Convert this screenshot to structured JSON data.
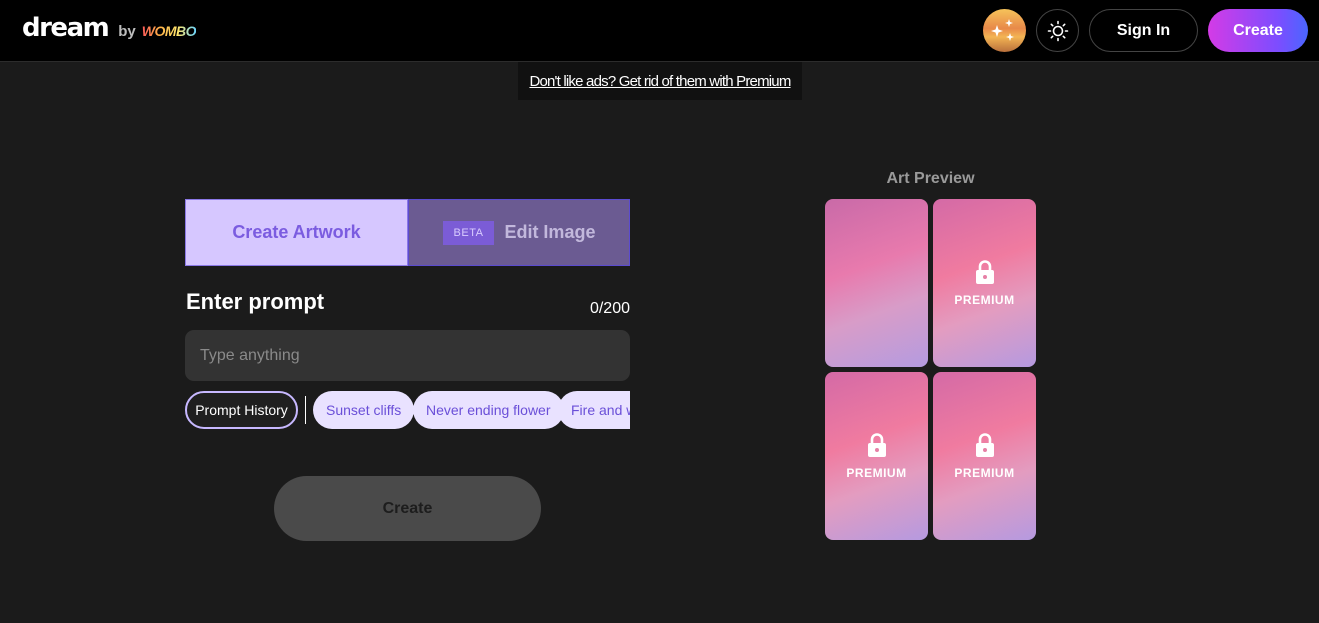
{
  "header": {
    "logo_text": "dream",
    "by_text": "by",
    "wombo_text": "WOMBO",
    "sign_in_label": "Sign In",
    "create_label": "Create"
  },
  "ad_banner": {
    "text": "Don't like ads? Get rid of them with Premium"
  },
  "tabs": {
    "create_artwork": "Create Artwork",
    "beta_badge": "BETA",
    "edit_image": "Edit Image"
  },
  "prompt": {
    "label": "Enter prompt",
    "counter": "0/200",
    "placeholder": "Type anything",
    "value": ""
  },
  "chips": {
    "history": "Prompt History",
    "suggestions": [
      "Sunset cliffs",
      "Never ending flower",
      "Fire and water"
    ]
  },
  "create_button": "Create",
  "art_preview": {
    "title": "Art Preview",
    "premium_label": "PREMIUM"
  },
  "colors": {
    "accent": "#7b5ce0",
    "create_gradient_start": "#d43be6",
    "create_gradient_end": "#4a66ff",
    "background": "#1b1b1b"
  },
  "icons": {
    "theme": "sun-icon",
    "lock": "lock-icon",
    "promo": "sparkle-avatar-icon"
  }
}
